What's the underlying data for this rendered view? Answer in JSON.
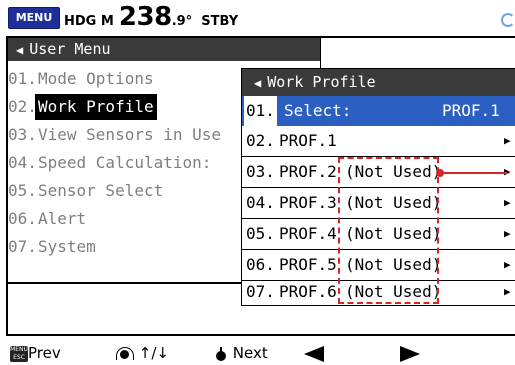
{
  "topbar": {
    "menu_button": "MENU",
    "hdg_label": "HDG M",
    "hdg_value": "238",
    "hdg_decimal": ".9°",
    "mode": "STBY"
  },
  "user_menu": {
    "title": "User Menu",
    "items": [
      {
        "num": "01.",
        "label": "Mode Options"
      },
      {
        "num": "02.",
        "label": "Work Profile"
      },
      {
        "num": "03.",
        "label": "View Sensors in Use"
      },
      {
        "num": "04.",
        "label": "Speed Calculation:"
      },
      {
        "num": "05.",
        "label": "Sensor Select"
      },
      {
        "num": "06.",
        "label": "Alert"
      },
      {
        "num": "07.",
        "label": "System"
      }
    ]
  },
  "work_profile": {
    "title": "Work Profile",
    "select_row": {
      "num": "01.",
      "label": "Select:",
      "value": "PROF.1"
    },
    "rows": [
      {
        "num": "02.",
        "name": "PROF.1",
        "status": ""
      },
      {
        "num": "03.",
        "name": "PROF.2",
        "status": "(Not Used)"
      },
      {
        "num": "04.",
        "name": "PROF.3",
        "status": "(Not Used)"
      },
      {
        "num": "05.",
        "name": "PROF.4",
        "status": "(Not Used)"
      },
      {
        "num": "06.",
        "name": "PROF.5",
        "status": "(Not Used)"
      },
      {
        "num": "07.",
        "name": "PROF.6",
        "status": "(Not Used)"
      }
    ]
  },
  "footer": {
    "menu_esc_top": "MENU",
    "menu_esc_bottom": "ESC",
    "prev": "Prev",
    "scroll": "↑/↓",
    "next": "Next"
  },
  "colors": {
    "menu_blue": "#1f2f9a",
    "highlight_blue": "#2b5fc2",
    "header_gray": "#3a3a3a",
    "annotation_red": "#d9252a"
  }
}
